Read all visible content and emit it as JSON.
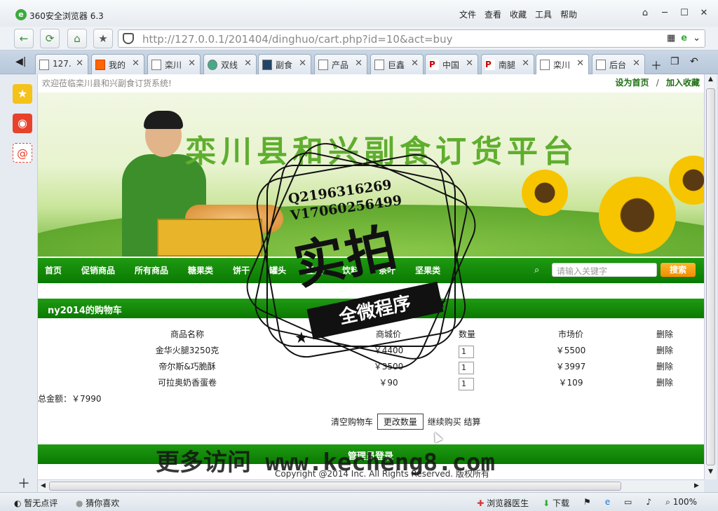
{
  "browser": {
    "title": "360安全浏览器 6.3",
    "menus": [
      "文件",
      "查看",
      "收藏",
      "工具",
      "帮助"
    ],
    "url": "http://127.0.0.1/201404/dinghuo/cart.php?id=10&act=buy"
  },
  "tabs": [
    {
      "label": "127."
    },
    {
      "label": "我的"
    },
    {
      "label": "栾川"
    },
    {
      "label": "双线"
    },
    {
      "label": "副食"
    },
    {
      "label": "产品"
    },
    {
      "label": "巨鑫"
    },
    {
      "label": "中国"
    },
    {
      "label": "南腿"
    },
    {
      "label": "栾川"
    },
    {
      "label": "后台"
    }
  ],
  "site": {
    "welcome": "欢迎莅临栾川县和兴副食订货系统!",
    "set_home": "设为首页",
    "separator": "/",
    "add_fav": "加入收藏",
    "banner_slogan": "栾川县和兴副食订货平台",
    "nav": [
      "首页",
      "促销商品",
      "所有商品",
      "糖果类",
      "饼干",
      "罐头",
      "豆类",
      "饮料",
      "茶叶",
      "坚果类"
    ],
    "search_placeholder": "请输入关键字",
    "search_btn": "搜索"
  },
  "cart": {
    "title": "ny2014的购物车",
    "headers": {
      "name": "商品名称",
      "price": "商城价",
      "qty": "数量",
      "market": "市场价",
      "del": "删除"
    },
    "items": [
      {
        "name": "金华火腿3250克",
        "price": "￥4400",
        "qty": "1",
        "market": "￥5500",
        "del": "删除"
      },
      {
        "name": "帝尔斯&巧脆酥",
        "price": "￥3500",
        "qty": "1",
        "market": "￥3997",
        "del": "删除"
      },
      {
        "name": "可拉奥奶香蛋卷",
        "price": "￥90",
        "qty": "1",
        "market": "￥109",
        "del": "删除"
      }
    ],
    "total": "总金额：￥7990",
    "clear": "清空购物车",
    "update": "更改数量",
    "continue": "继续购买",
    "checkout": "结算"
  },
  "footer": {
    "admin": "管理员登录",
    "copyright": "Copyright @2014 Inc. All Rights Reserved. 版权所有"
  },
  "status": {
    "left1": "暂无点评",
    "left2": "猜你喜欢",
    "doctor": "浏览器医生",
    "download": "下载",
    "zoom": "100%"
  },
  "watermark": {
    "qq": "Q2196316269",
    "v": "V17060256499",
    "big": "实拍",
    "ribbon": "全微程序",
    "bottom": "更多访问 www.kecheng8.com"
  }
}
